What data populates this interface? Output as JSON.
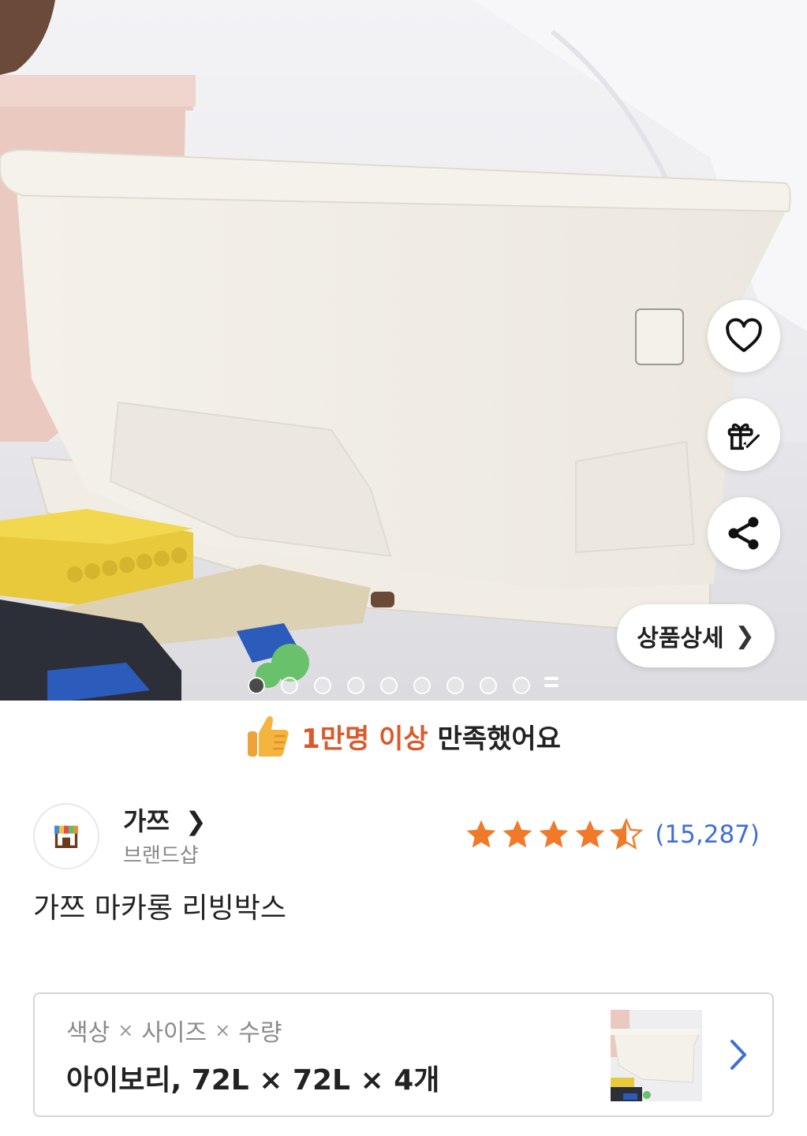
{
  "hero": {
    "slide_count": 9,
    "active_slide": 1,
    "detail_button_label": "상품상세",
    "icons": [
      "heart-icon",
      "gift-rocket-icon",
      "share-icon",
      "chevron-right-icon"
    ]
  },
  "satisfaction": {
    "highlight": "1만명 이상",
    "text": "만족했어요"
  },
  "brand": {
    "name": "가쯔",
    "type": "브랜드샵",
    "logo_icon": "storefront-icon"
  },
  "rating": {
    "stars": 4.5,
    "max": 5,
    "count": "(15,287)",
    "star_color": "#f07a2a"
  },
  "product": {
    "title": "가쯔 마카롱 리빙박스"
  },
  "options": {
    "labels": [
      "색상",
      "사이즈",
      "수량"
    ],
    "separator": "×",
    "value": "아이보리, 72L × 72L × 4개"
  },
  "colors": {
    "accent_orange": "#d95a2b",
    "link_blue": "#3f6fd6"
  }
}
